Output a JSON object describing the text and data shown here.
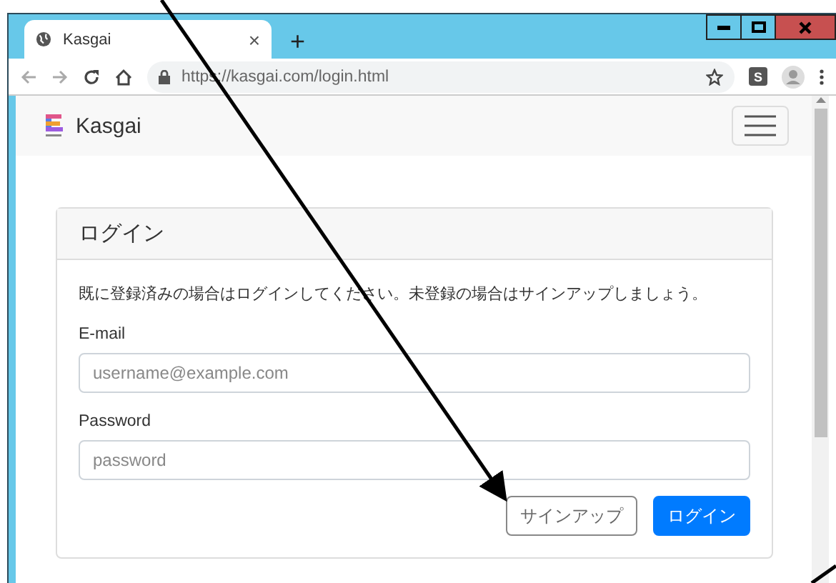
{
  "browser": {
    "tab_title": "Kasgai",
    "tab_close": "×",
    "new_tab": "+",
    "url": "https://kasgai.com/login.html",
    "extension_badge": "S"
  },
  "navbar": {
    "brand": "Kasgai"
  },
  "card": {
    "title": "ログイン",
    "intro": "既に登録済みの場合はログインしてください。未登録の場合はサインアップしましょう。",
    "fields": [
      {
        "label": "E-mail",
        "placeholder": "username@example.com"
      },
      {
        "label": "Password",
        "placeholder": "password"
      }
    ],
    "buttons": [
      {
        "label": "サインアップ",
        "kind": "outline"
      },
      {
        "label": "ログイン",
        "kind": "primary"
      }
    ]
  }
}
